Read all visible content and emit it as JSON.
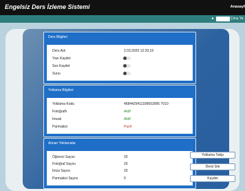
{
  "header": {
    "title": "Engelsiz Ders İzleme Sistemi",
    "nav_label": "Anasayf"
  },
  "subheader": {
    "arrow": "►",
    "user_value": "",
    "logout_label": "Çıkış Ya"
  },
  "ders": {
    "title": "Ders Bilgileri",
    "rows": [
      {
        "label": "Ders Adı",
        "value": "2.03.2020 12:33:16"
      },
      {
        "label": "Yazı Kaydet",
        "toggle": false
      },
      {
        "label": "Ses Kaydet",
        "toggle": false
      },
      {
        "label": "Sunu",
        "toggle": false
      }
    ]
  },
  "yoklama": {
    "title": "Yoklama Bilgileri",
    "rows": [
      {
        "label": "Yoklama Kodu",
        "value": "4684429411189653995 7010",
        "color": "#222222"
      },
      {
        "label": "Fotoğraflı",
        "value": "Aktif",
        "color": "#2e8b2e"
      },
      {
        "label": "İmzalı",
        "value": "Aktif",
        "color": "#2e8b2e"
      },
      {
        "label": "Parmakizi",
        "value": "Pasif",
        "color": "#c0392b"
      }
    ]
  },
  "alinan": {
    "title": "Alınan Yoklamalar",
    "rows": [
      {
        "label": "Öğrenci Sayısı",
        "value": "20"
      },
      {
        "label": "Fotoğraf Sayısı",
        "value": "20"
      },
      {
        "label": "İmza Sayısı",
        "value": "20"
      },
      {
        "label": "Parmakizi Sayısı",
        "value": "0"
      }
    ]
  },
  "actions": {
    "yoklama_takip": "Yoklama Takip",
    "ders_izle": "Dersi İzle",
    "kaydet": "Kaydet"
  },
  "colors": {
    "topbar": "#111111",
    "subbar": "#2f7e7e",
    "panel": "#1f6ec7",
    "active": "#2e8b2e",
    "passive": "#c0392b"
  }
}
